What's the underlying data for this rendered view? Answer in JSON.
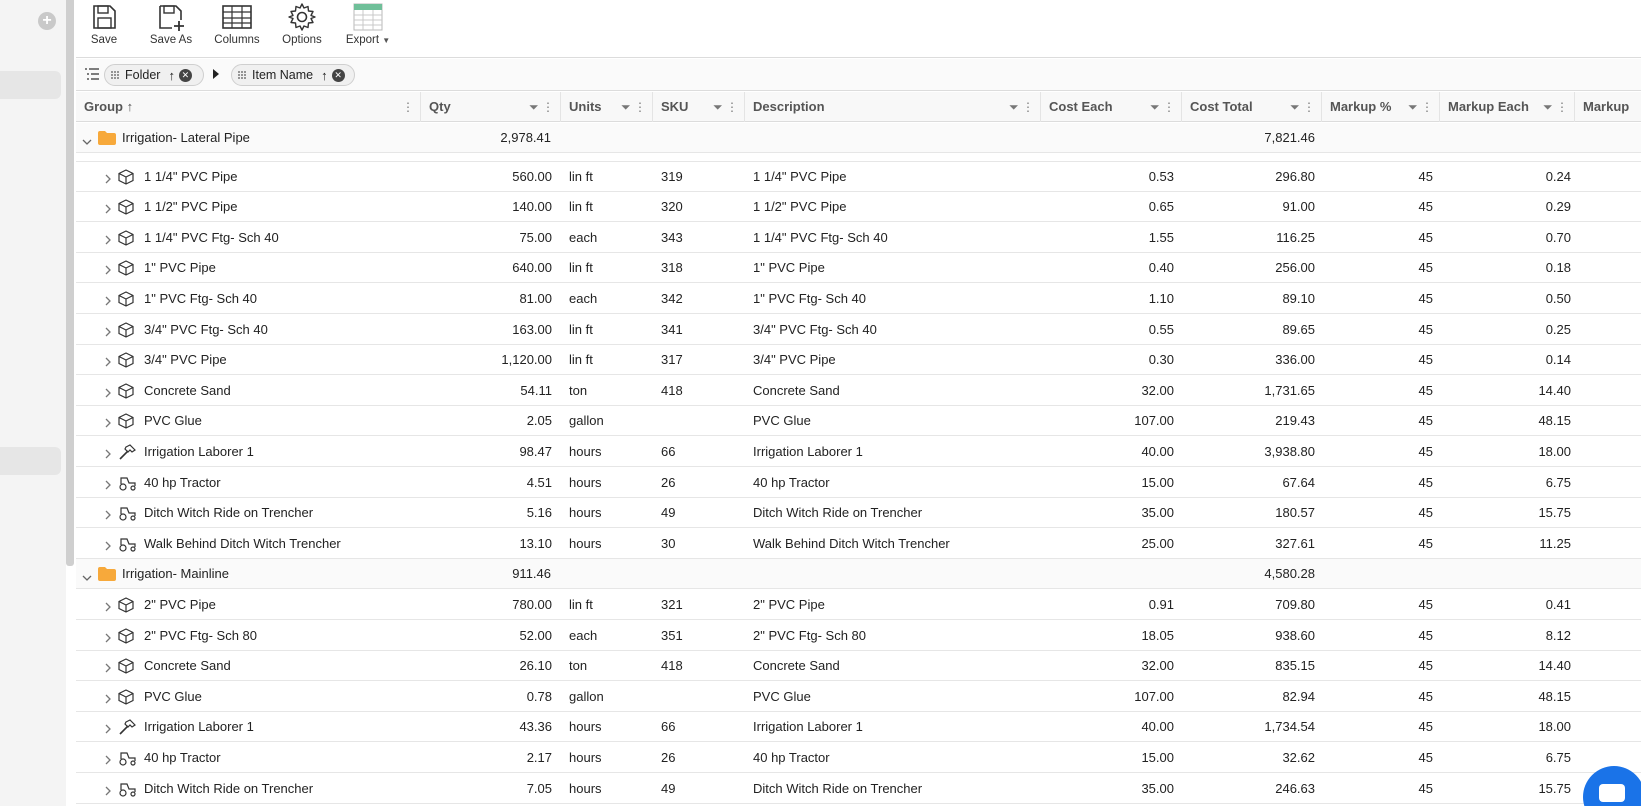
{
  "toolbar": {
    "save": "Save",
    "save_as": "Save As",
    "columns": "Columns",
    "options": "Options",
    "export": "Export"
  },
  "grouping": {
    "chips": [
      {
        "label": "Folder"
      },
      {
        "label": "Item Name"
      }
    ]
  },
  "columns": [
    "Group",
    "Qty",
    "Units",
    "SKU",
    "Description",
    "Cost Each",
    "Cost Total",
    "Markup %",
    "Markup Each",
    "Markup"
  ],
  "rows": [
    {
      "type": "group",
      "name": "Irrigation- Lateral Pipe",
      "qty": "2,978.41",
      "cost_total": "7,821.46"
    },
    {
      "type": "item",
      "icon": "box-icon",
      "name": "1 1/4\" PVC Pipe",
      "qty": "560.00",
      "units": "lin ft",
      "sku": "319",
      "desc": "1 1/4\" PVC Pipe",
      "cost_each": "0.53",
      "cost_total": "296.80",
      "markup_pct": "45",
      "markup_each": "0.24"
    },
    {
      "type": "item",
      "icon": "box-icon",
      "name": "1 1/2\" PVC Pipe",
      "qty": "140.00",
      "units": "lin ft",
      "sku": "320",
      "desc": "1 1/2\" PVC Pipe",
      "cost_each": "0.65",
      "cost_total": "91.00",
      "markup_pct": "45",
      "markup_each": "0.29"
    },
    {
      "type": "item",
      "icon": "box-icon",
      "name": "1 1/4\" PVC Ftg- Sch 40",
      "qty": "75.00",
      "units": "each",
      "sku": "343",
      "desc": "1 1/4\" PVC Ftg- Sch 40",
      "cost_each": "1.55",
      "cost_total": "116.25",
      "markup_pct": "45",
      "markup_each": "0.70"
    },
    {
      "type": "item",
      "icon": "box-icon",
      "name": "1\" PVC Pipe",
      "qty": "640.00",
      "units": "lin ft",
      "sku": "318",
      "desc": "1\" PVC Pipe",
      "cost_each": "0.40",
      "cost_total": "256.00",
      "markup_pct": "45",
      "markup_each": "0.18"
    },
    {
      "type": "item",
      "icon": "box-icon",
      "name": "1\" PVC Ftg- Sch 40",
      "qty": "81.00",
      "units": "each",
      "sku": "342",
      "desc": "1\" PVC Ftg- Sch 40",
      "cost_each": "1.10",
      "cost_total": "89.10",
      "markup_pct": "45",
      "markup_each": "0.50"
    },
    {
      "type": "item",
      "icon": "box-icon",
      "name": "3/4\" PVC Ftg- Sch 40",
      "qty": "163.00",
      "units": "lin ft",
      "sku": "341",
      "desc": "3/4\" PVC Ftg- Sch 40",
      "cost_each": "0.55",
      "cost_total": "89.65",
      "markup_pct": "45",
      "markup_each": "0.25"
    },
    {
      "type": "item",
      "icon": "box-icon",
      "name": "3/4\" PVC Pipe",
      "qty": "1,120.00",
      "units": "lin ft",
      "sku": "317",
      "desc": "3/4\" PVC Pipe",
      "cost_each": "0.30",
      "cost_total": "336.00",
      "markup_pct": "45",
      "markup_each": "0.14"
    },
    {
      "type": "item",
      "icon": "box-icon",
      "name": "Concrete Sand",
      "qty": "54.11",
      "units": "ton",
      "sku": "418",
      "desc": "Concrete Sand",
      "cost_each": "32.00",
      "cost_total": "1,731.65",
      "markup_pct": "45",
      "markup_each": "14.40"
    },
    {
      "type": "item",
      "icon": "box-icon",
      "name": "PVC Glue",
      "qty": "2.05",
      "units": "gallon",
      "sku": "",
      "desc": "PVC Glue",
      "cost_each": "107.00",
      "cost_total": "219.43",
      "markup_pct": "45",
      "markup_each": "48.15"
    },
    {
      "type": "item",
      "icon": "hammer-icon",
      "name": "Irrigation Laborer 1",
      "qty": "98.47",
      "units": "hours",
      "sku": "66",
      "desc": "Irrigation Laborer 1",
      "cost_each": "40.00",
      "cost_total": "3,938.80",
      "markup_pct": "45",
      "markup_each": "18.00"
    },
    {
      "type": "item",
      "icon": "tractor-icon",
      "name": "40 hp Tractor",
      "qty": "4.51",
      "units": "hours",
      "sku": "26",
      "desc": "40 hp Tractor",
      "cost_each": "15.00",
      "cost_total": "67.64",
      "markup_pct": "45",
      "markup_each": "6.75"
    },
    {
      "type": "item",
      "icon": "tractor-icon",
      "name": "Ditch Witch Ride on Trencher",
      "qty": "5.16",
      "units": "hours",
      "sku": "49",
      "desc": "Ditch Witch Ride on Trencher",
      "cost_each": "35.00",
      "cost_total": "180.57",
      "markup_pct": "45",
      "markup_each": "15.75"
    },
    {
      "type": "item",
      "icon": "tractor-icon",
      "name": "Walk Behind Ditch Witch Trencher",
      "qty": "13.10",
      "units": "hours",
      "sku": "30",
      "desc": "Walk Behind Ditch Witch Trencher",
      "cost_each": "25.00",
      "cost_total": "327.61",
      "markup_pct": "45",
      "markup_each": "11.25"
    },
    {
      "type": "group",
      "name": "Irrigation- Mainline",
      "qty": "911.46",
      "cost_total": "4,580.28"
    },
    {
      "type": "item",
      "icon": "box-icon",
      "name": "2\" PVC Pipe",
      "qty": "780.00",
      "units": "lin ft",
      "sku": "321",
      "desc": "2\" PVC Pipe",
      "cost_each": "0.91",
      "cost_total": "709.80",
      "markup_pct": "45",
      "markup_each": "0.41"
    },
    {
      "type": "item",
      "icon": "box-icon",
      "name": "2\" PVC Ftg- Sch 80",
      "qty": "52.00",
      "units": "each",
      "sku": "351",
      "desc": "2\" PVC Ftg- Sch 80",
      "cost_each": "18.05",
      "cost_total": "938.60",
      "markup_pct": "45",
      "markup_each": "8.12"
    },
    {
      "type": "item",
      "icon": "box-icon",
      "name": "Concrete Sand",
      "qty": "26.10",
      "units": "ton",
      "sku": "418",
      "desc": "Concrete Sand",
      "cost_each": "32.00",
      "cost_total": "835.15",
      "markup_pct": "45",
      "markup_each": "14.40"
    },
    {
      "type": "item",
      "icon": "box-icon",
      "name": "PVC Glue",
      "qty": "0.78",
      "units": "gallon",
      "sku": "",
      "desc": "PVC Glue",
      "cost_each": "107.00",
      "cost_total": "82.94",
      "markup_pct": "45",
      "markup_each": "48.15"
    },
    {
      "type": "item",
      "icon": "hammer-icon",
      "name": "Irrigation Laborer 1",
      "qty": "43.36",
      "units": "hours",
      "sku": "66",
      "desc": "Irrigation Laborer 1",
      "cost_each": "40.00",
      "cost_total": "1,734.54",
      "markup_pct": "45",
      "markup_each": "18.00"
    },
    {
      "type": "item",
      "icon": "tractor-icon",
      "name": "40 hp Tractor",
      "qty": "2.17",
      "units": "hours",
      "sku": "26",
      "desc": "40 hp Tractor",
      "cost_each": "15.00",
      "cost_total": "32.62",
      "markup_pct": "45",
      "markup_each": "6.75"
    },
    {
      "type": "item",
      "icon": "tractor-icon",
      "name": "Ditch Witch Ride on Trencher",
      "qty": "7.05",
      "units": "hours",
      "sku": "49",
      "desc": "Ditch Witch Ride on Trencher",
      "cost_each": "35.00",
      "cost_total": "246.63",
      "markup_pct": "45",
      "markup_each": "15.75"
    }
  ],
  "colors": {
    "folder": "#f7a93b",
    "accent": "#1a73e8",
    "export_icon": "#6fbf99"
  }
}
